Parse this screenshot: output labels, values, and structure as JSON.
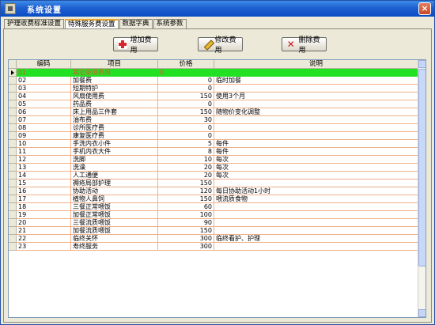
{
  "window": {
    "title": "系统设置",
    "close_glyph": "×"
  },
  "tabs": [
    {
      "label": "护理收费标准设置",
      "active": false
    },
    {
      "label": "特殊服务费设置",
      "active": true
    },
    {
      "label": "数据字典",
      "active": false
    },
    {
      "label": "系统参数",
      "active": false
    }
  ],
  "toolbar": {
    "add_label": "增加费用",
    "edit_label": "修改费用",
    "delete_label": "删除费用"
  },
  "table": {
    "headers": [
      "编码",
      "项目",
      "价格",
      "说明"
    ],
    "rows": [
      {
        "code": "01",
        "item": "其它杂项费用",
        "price": "0",
        "note": ""
      },
      {
        "code": "02",
        "item": "加餐费",
        "price": "0",
        "note": "临时加餐"
      },
      {
        "code": "03",
        "item": "短期特护",
        "price": "0",
        "note": ""
      },
      {
        "code": "04",
        "item": "风扇使用费",
        "price": "150",
        "note": "使用3个月"
      },
      {
        "code": "05",
        "item": "药品费",
        "price": "0",
        "note": ""
      },
      {
        "code": "06",
        "item": "床上用品三件套",
        "price": "150",
        "note": "随物价变化调整"
      },
      {
        "code": "07",
        "item": "油布费",
        "price": "30",
        "note": ""
      },
      {
        "code": "08",
        "item": "诊所医疗费",
        "price": "0",
        "note": ""
      },
      {
        "code": "09",
        "item": "康复医疗费",
        "price": "0",
        "note": ""
      },
      {
        "code": "10",
        "item": "手洗内衣小件",
        "price": "5",
        "note": "每件"
      },
      {
        "code": "11",
        "item": "手机内衣大件",
        "price": "8",
        "note": "每件"
      },
      {
        "code": "12",
        "item": "洗脚",
        "price": "10",
        "note": "每次"
      },
      {
        "code": "13",
        "item": "洗澡",
        "price": "20",
        "note": "每次"
      },
      {
        "code": "14",
        "item": "人工通便",
        "price": "20",
        "note": "每次"
      },
      {
        "code": "15",
        "item": "褥疮局部护理",
        "price": "150",
        "note": ""
      },
      {
        "code": "16",
        "item": "协助活动",
        "price": "120",
        "note": "每日协助活动1小时"
      },
      {
        "code": "17",
        "item": "植物人鼻饲",
        "price": "150",
        "note": "喂流质食物"
      },
      {
        "code": "18",
        "item": "三餐正常喂饭",
        "price": "60",
        "note": ""
      },
      {
        "code": "19",
        "item": "加餐正常喂饭",
        "price": "100",
        "note": ""
      },
      {
        "code": "20",
        "item": "三餐流质喂饭",
        "price": "90",
        "note": ""
      },
      {
        "code": "21",
        "item": "加餐流质喂饭",
        "price": "150",
        "note": ""
      },
      {
        "code": "22",
        "item": "临终关怀",
        "price": "300",
        "note": "临终看护、护理"
      },
      {
        "code": "23",
        "item": "寿终服务",
        "price": "300",
        "note": ""
      }
    ]
  },
  "colors": {
    "selected_row_bg": "#22e022",
    "selected_row_text": "#e8503a",
    "title_bar": "#1e5fd0"
  }
}
